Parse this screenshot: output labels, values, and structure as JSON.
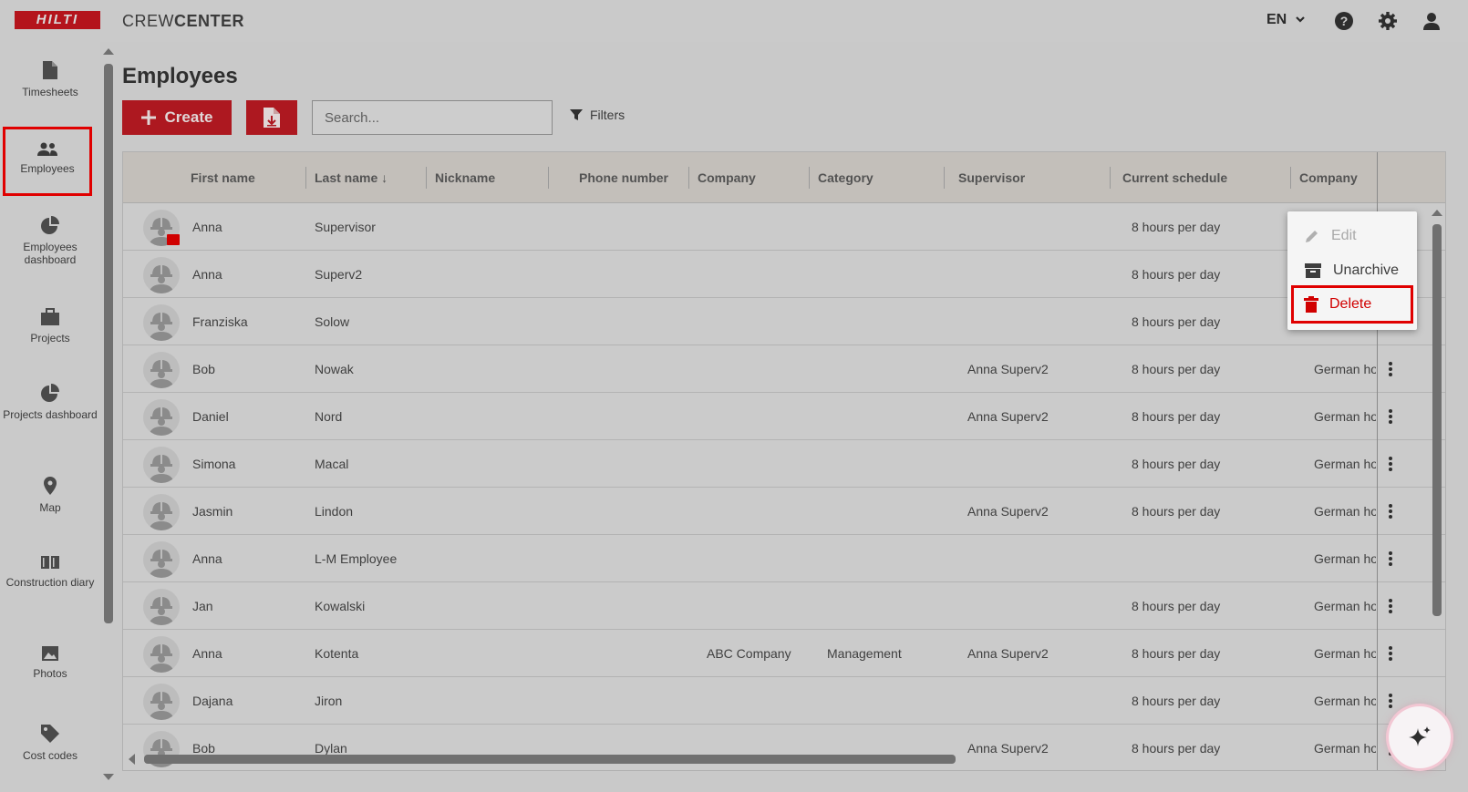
{
  "header": {
    "logo_text": "HILTI",
    "app_title_light": "CREW",
    "app_title_bold": "CENTER",
    "language": "EN"
  },
  "sidebar": {
    "items": [
      {
        "label": "Timesheets",
        "icon": "document-icon"
      },
      {
        "label": "Employees",
        "icon": "people-icon",
        "active": true
      },
      {
        "label": "Employees dashboard",
        "icon": "pie-chart-icon"
      },
      {
        "label": "Projects",
        "icon": "briefcase-icon"
      },
      {
        "label": "Projects dashboard",
        "icon": "pie-chart-icon"
      },
      {
        "label": "Map",
        "icon": "map-pin-icon"
      },
      {
        "label": "Construction diary",
        "icon": "book-icon"
      },
      {
        "label": "Photos",
        "icon": "image-icon"
      },
      {
        "label": "Cost codes",
        "icon": "tag-icon"
      }
    ]
  },
  "main": {
    "title": "Employees",
    "create_label": "Create",
    "search_placeholder": "Search...",
    "filters_label": "Filters"
  },
  "table": {
    "columns": [
      "First name",
      "Last name",
      "Nickname",
      "Phone number",
      "Company",
      "Category",
      "Supervisor",
      "Current schedule",
      "Company"
    ],
    "sort_indicator": "↓",
    "rows": [
      {
        "first": "Anna",
        "last": "Supervisor",
        "company": "",
        "category": "",
        "supervisor": "",
        "schedule": "8 hours per day",
        "company2": "",
        "archived": true
      },
      {
        "first": "Anna",
        "last": "Superv2",
        "company": "",
        "category": "",
        "supervisor": "",
        "schedule": "8 hours per day",
        "company2": ""
      },
      {
        "first": "Franziska",
        "last": "Solow",
        "company": "",
        "category": "",
        "supervisor": "",
        "schedule": "8 hours per day",
        "company2": ""
      },
      {
        "first": "Bob",
        "last": "Nowak",
        "company": "",
        "category": "",
        "supervisor": "Anna Superv2",
        "schedule": "8 hours per day",
        "company2": "German ho"
      },
      {
        "first": "Daniel",
        "last": "Nord",
        "company": "",
        "category": "",
        "supervisor": "Anna Superv2",
        "schedule": "8 hours per day",
        "company2": "German ho"
      },
      {
        "first": "Simona",
        "last": "Macal",
        "company": "",
        "category": "",
        "supervisor": "",
        "schedule": "8 hours per day",
        "company2": "German ho"
      },
      {
        "first": "Jasmin",
        "last": "Lindon",
        "company": "",
        "category": "",
        "supervisor": "Anna Superv2",
        "schedule": "8 hours per day",
        "company2": "German ho"
      },
      {
        "first": "Anna",
        "last": "L-M Employee",
        "company": "",
        "category": "",
        "supervisor": "",
        "schedule": "",
        "company2": "German ho"
      },
      {
        "first": "Jan",
        "last": "Kowalski",
        "company": "",
        "category": "",
        "supervisor": "",
        "schedule": "8 hours per day",
        "company2": "German ho"
      },
      {
        "first": "Anna",
        "last": "Kotenta",
        "company": "ABC Company",
        "category": "Management",
        "supervisor": "Anna Superv2",
        "schedule": "8 hours per day",
        "company2": "German ho"
      },
      {
        "first": "Dajana",
        "last": "Jiron",
        "company": "",
        "category": "",
        "supervisor": "",
        "schedule": "8 hours per day",
        "company2": "German ho"
      },
      {
        "first": "Bob",
        "last": "Dylan",
        "company": "",
        "category": "",
        "supervisor": "Anna Superv2",
        "schedule": "8 hours per day",
        "company2": "German ho"
      }
    ]
  },
  "context_menu": {
    "edit_label": "Edit",
    "unarchive_label": "Unarchive",
    "delete_label": "Delete"
  },
  "colors": {
    "brand_red": "#ad1820",
    "highlight_red": "#e00000"
  }
}
